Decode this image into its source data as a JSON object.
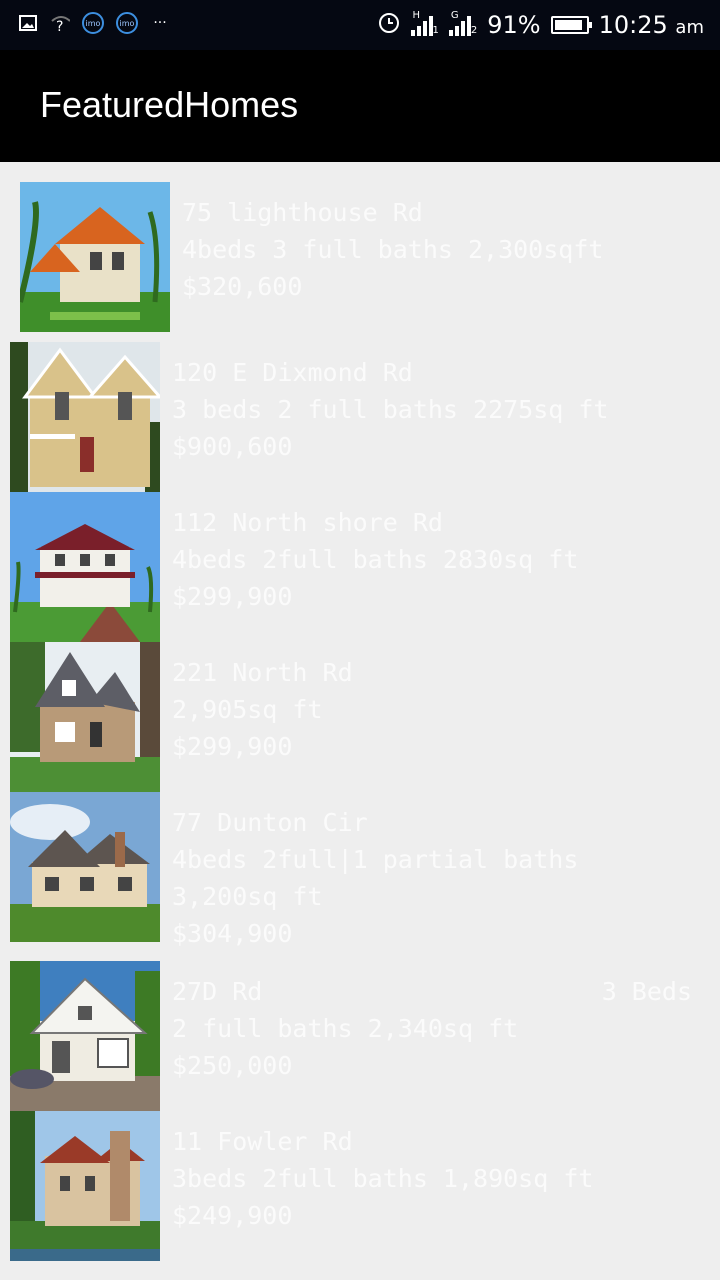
{
  "status_bar": {
    "icons_left": [
      "image-icon",
      "wifi-question-icon",
      "imo-icon",
      "imo-icon",
      "more-icon"
    ],
    "imo_label": "imo",
    "more": "···",
    "alarm_icon": "alarm-clock-icon",
    "net1": "H",
    "sim1": "1",
    "net2": "G",
    "sim2": "2",
    "battery_percent": "91%",
    "battery_level": 0.91,
    "time": "10:25",
    "ampm": "am"
  },
  "app_bar": {
    "title": "FeaturedHomes"
  },
  "colors": {
    "app_bar": "#000000",
    "status_bar": "#050812",
    "background": "#eeeeee",
    "text": "#fbfbfb"
  },
  "listings": [
    {
      "address": "75 lighthouse Rd",
      "line2": "4beds 3 full baths 2,300sqft",
      "price": "$320,600"
    },
    {
      "address": "120 E Dixmond Rd",
      "line2": "3 beds 2 full baths 2275sq ft",
      "price": "$900,600"
    },
    {
      "address": "112 North shore Rd",
      "line2": "4beds 2full baths 2830sq ft",
      "price": "$299,900"
    },
    {
      "address": "221 North Rd",
      "line2": "2,905sq ft",
      "price": "$299,900"
    },
    {
      "address": "77 Dunton Cir",
      "line2": "4beds 2full|1 partial baths",
      "line3": "3,200sq ft",
      "price": "$304,900"
    },
    {
      "address": "27D Rd",
      "beds": "3 Beds",
      "line2": "2 full baths 2,340sq ft",
      "price": "$250,000"
    },
    {
      "address": "11 Fowler Rd",
      "line2": "3beds 2full baths 1,890sq ft",
      "price": "$249,900"
    }
  ]
}
